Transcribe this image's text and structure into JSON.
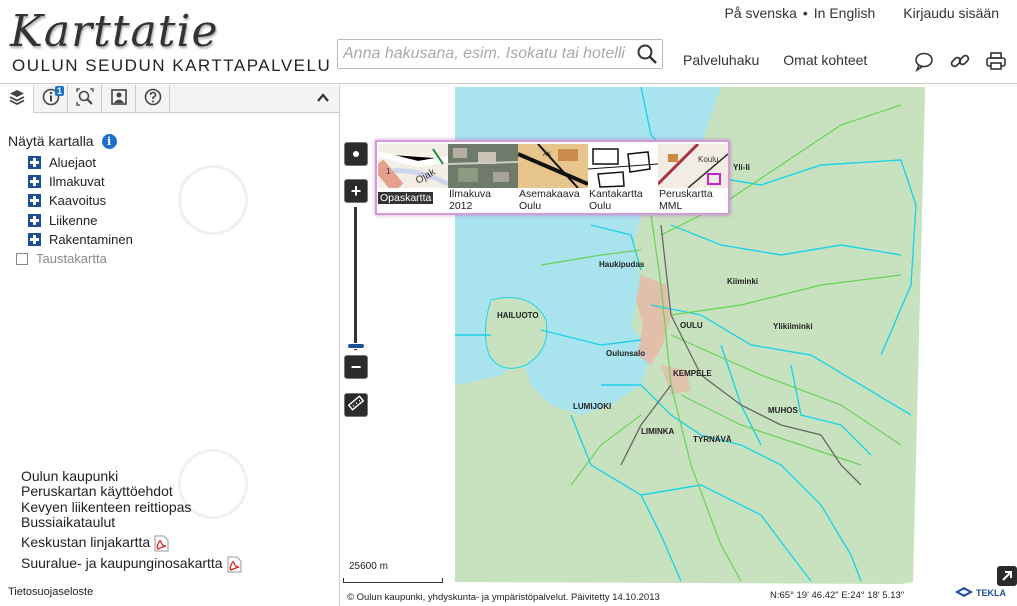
{
  "header": {
    "logo_script": "Karttatie",
    "logo_sub": "OULUN SEUDUN KARTTAPALVELU",
    "lang_sv": "På svenska",
    "lang_sep": "•",
    "lang_en": "In English",
    "login": "Kirjaudu sisään",
    "search_placeholder": "Anna hakusana, esim. Isokatu tai hotelli",
    "nav_service_search": "Palveluhaku",
    "nav_own_items": "Omat kohteet",
    "icons": [
      "chat-icon",
      "link-icon",
      "print-icon"
    ]
  },
  "panel": {
    "tabs": [
      {
        "name": "layers-tab",
        "icon": "layers-icon"
      },
      {
        "name": "info-tab",
        "icon": "info-icon",
        "badge": "1"
      },
      {
        "name": "search-tab",
        "icon": "zoom-search-icon"
      },
      {
        "name": "image-tab",
        "icon": "image-icon"
      },
      {
        "name": "help-tab",
        "icon": "help-icon"
      }
    ],
    "layers_title": "Näytä kartalla",
    "layers": [
      "Aluejaot",
      "Ilmakuvat",
      "Kaavoitus",
      "Liikenne",
      "Rakentaminen"
    ],
    "base_layer": "Taustakartta",
    "links": [
      "Oulun kaupunki",
      "Peruskartan käyttöehdot",
      "Kevyen liikenteen reittiopas",
      "Bussiaikataulut",
      "Keskustan linjakartta",
      "Suuralue- ja kaupunginosakartta"
    ],
    "privacy": "Tietosuojaseloste"
  },
  "map": {
    "basemaps": [
      {
        "label": "Opaskartta",
        "selected": true
      },
      {
        "label": "Ilmakuva 2012",
        "selected": false
      },
      {
        "label": "Asemakaava Oulu",
        "selected": false
      },
      {
        "label": "Kantakartta Oulu",
        "selected": false
      },
      {
        "label": "Peruskartta MML",
        "selected": false
      }
    ],
    "places": [
      "Yli-Ii",
      "Haukipudas",
      "Kiiminki",
      "HAILUOTO",
      "OULU",
      "Ylikiiminki",
      "Oulunsalo",
      "KEMPELE",
      "LUMIJOKI",
      "MUHOS",
      "LIMINKA",
      "TYRNÄVÄ"
    ],
    "scale_label": "25600 m",
    "copyright": "© Oulun kaupunki, yhdyskunta- ja ympäristöpalvelut. Päivitetty 14.10.2013",
    "coords": "N:65° 19' 46.42\" E:24° 18' 5.13\"",
    "brand": "TEKLA"
  },
  "colors": {
    "land": "#c8e2bf",
    "sea": "#a9e3ee",
    "boundary": "#1fd3e6",
    "road": "#6ad15a",
    "accent": "#1c4f99"
  }
}
